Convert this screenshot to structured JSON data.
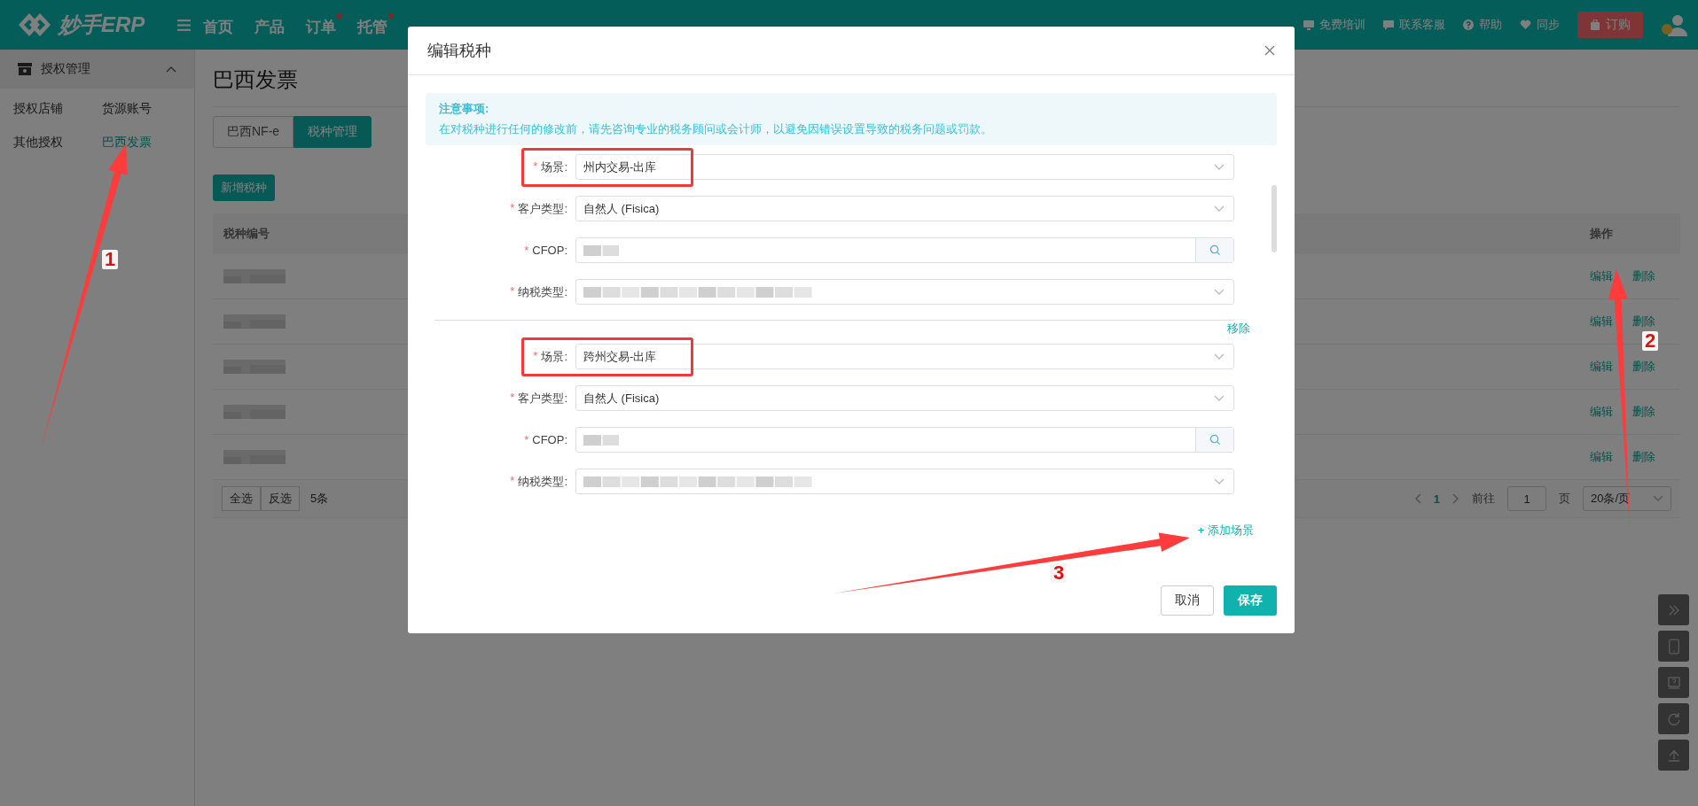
{
  "top_nav": {
    "logo": "妙手ERP",
    "items": [
      {
        "label": "首页",
        "dot": false
      },
      {
        "label": "产品",
        "dot": false
      },
      {
        "label": "订单",
        "dot": true
      },
      {
        "label": "托管",
        "dot": true
      }
    ],
    "links": [
      {
        "kind": "training",
        "label": "免费培训"
      },
      {
        "kind": "service",
        "label": "联系客服"
      },
      {
        "kind": "help",
        "label": "帮助"
      },
      {
        "kind": "sync",
        "label": "同步"
      }
    ],
    "order_button": "订购"
  },
  "sidebar": {
    "section": "授权管理",
    "expanded": true,
    "items": [
      {
        "label": "授权店铺",
        "selected": false
      },
      {
        "label": "货源账号",
        "selected": false
      },
      {
        "label": "其他授权",
        "selected": false
      },
      {
        "label": "巴西发票",
        "selected": true
      }
    ]
  },
  "page": {
    "title": "巴西发票",
    "tabs": [
      {
        "label": "巴西NF-e",
        "selected": false
      },
      {
        "label": "税种管理",
        "selected": true
      }
    ],
    "add_button": "新增税种",
    "table": {
      "columns": [
        "税种编号",
        "操作"
      ],
      "rows": [
        {
          "actions": [
            "编辑",
            "删除"
          ]
        },
        {
          "actions": [
            "编辑",
            "删除"
          ]
        },
        {
          "actions": [
            "编辑",
            "删除"
          ]
        },
        {
          "actions": [
            "编辑",
            "删除"
          ]
        },
        {
          "actions": [
            "编辑",
            "删除"
          ]
        }
      ]
    },
    "footer": {
      "select_all": "全选",
      "invert": "反选",
      "count": "5条"
    },
    "pagination": {
      "pages": [
        {
          "label": "1",
          "selected": true
        }
      ],
      "goto": "前往",
      "page_input": "1",
      "page_suffix": "页",
      "page_size": "20条/页"
    }
  },
  "modal": {
    "title": "编辑税种",
    "notice": {
      "title": "注意事项:",
      "text": "在对税种进行任何的修改前，请先咨询专业的税务顾问或会计师，以避免因错误设置导致的税务问题或罚款。"
    },
    "groups": [
      {
        "fields": [
          {
            "required_mark": "*",
            "label": "场景:",
            "kind": "select",
            "value": "州内交易-出库",
            "redacted": false,
            "highlighted": true
          },
          {
            "required_mark": "*",
            "label": "客户类型:",
            "kind": "select",
            "value": "自然人 (Fisica)",
            "redacted": false,
            "highlighted": false
          },
          {
            "required_mark": "*",
            "label": "CFOP:",
            "kind": "search",
            "redacted": true,
            "highlighted": false
          },
          {
            "required_mark": "*",
            "label": "纳税类型:",
            "kind": "select",
            "redacted": true,
            "highlighted": false
          }
        ]
      },
      {
        "remove_link": "移除",
        "fields": [
          {
            "required_mark": "*",
            "label": "场景:",
            "kind": "select",
            "value": "跨州交易-出库",
            "redacted": false,
            "highlighted": true
          },
          {
            "required_mark": "*",
            "label": "客户类型:",
            "kind": "select",
            "value": "自然人 (Fisica)",
            "redacted": false,
            "highlighted": false
          },
          {
            "required_mark": "*",
            "label": "CFOP:",
            "kind": "search",
            "redacted": true,
            "highlighted": false
          },
          {
            "required_mark": "*",
            "label": "纳税类型:",
            "kind": "select",
            "redacted": true,
            "highlighted": false
          }
        ]
      }
    ],
    "add_link": "+ 添加场景",
    "cancel": "取消",
    "save": "保存"
  },
  "annotations": [
    {
      "label": "1"
    },
    {
      "label": "2"
    },
    {
      "label": "3"
    }
  ]
}
